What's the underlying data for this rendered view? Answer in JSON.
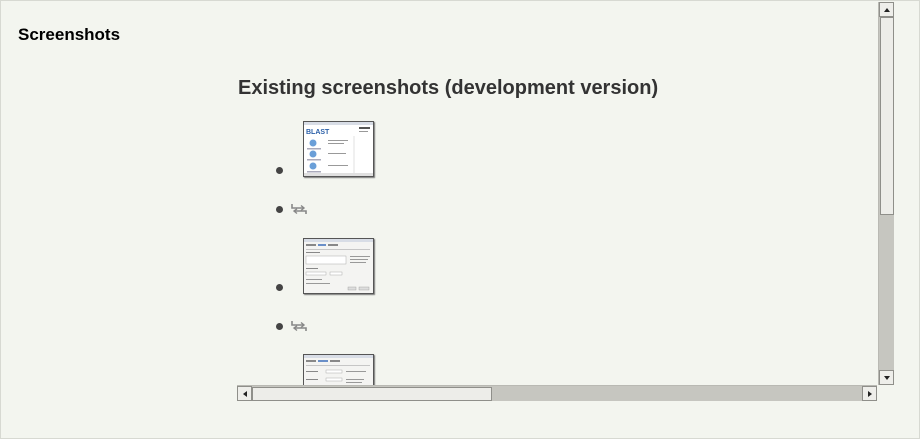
{
  "section": {
    "title": "Screenshots"
  },
  "content": {
    "heading": "Existing screenshots (development version)",
    "items": [
      {
        "kind": "thumbnail",
        "icon": "screenshot-thumbnail"
      },
      {
        "kind": "compare",
        "icon": "swap-arrows-icon"
      },
      {
        "kind": "thumbnail",
        "icon": "screenshot-thumbnail"
      },
      {
        "kind": "compare",
        "icon": "swap-arrows-icon"
      },
      {
        "kind": "thumbnail",
        "icon": "screenshot-thumbnail"
      }
    ]
  },
  "thumbnails": {
    "first_logo_text": "BLAST"
  },
  "colors": {
    "page_background": "#f2f4ee",
    "heading": "#333333",
    "scrollbar_track": "#c6c6c0",
    "scrollbar_thumb": "#ededE9"
  }
}
